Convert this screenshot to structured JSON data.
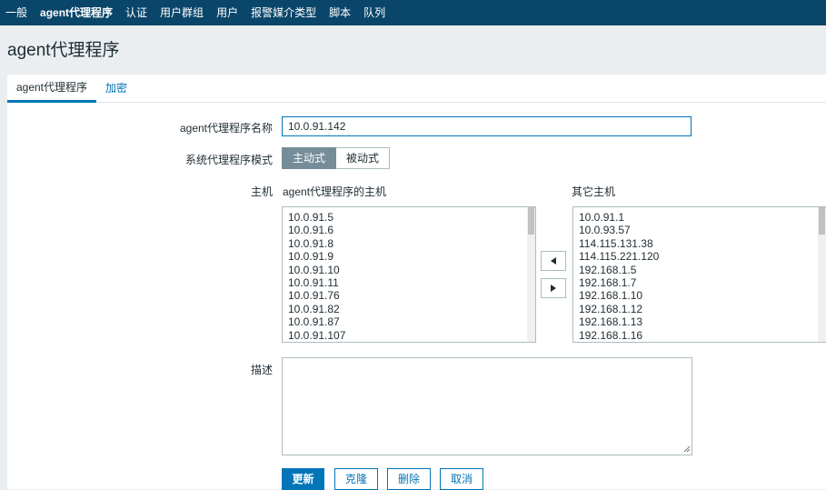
{
  "topnav": {
    "items": [
      {
        "label": "一般"
      },
      {
        "label": "agent代理程序"
      },
      {
        "label": "认证"
      },
      {
        "label": "用户群组"
      },
      {
        "label": "用户"
      },
      {
        "label": "报警媒介类型"
      },
      {
        "label": "脚本"
      },
      {
        "label": "队列"
      }
    ]
  },
  "page": {
    "title": "agent代理程序"
  },
  "tabs": {
    "active": "agent代理程序",
    "encryption": "加密"
  },
  "form": {
    "name_label": "agent代理程序名称",
    "name_value": "10.0.91.142",
    "mode_label": "系统代理程序模式",
    "mode_active": "主动式",
    "mode_passive": "被动式",
    "hosts_label": "主机",
    "proxy_hosts_header": "agent代理程序的主机",
    "other_hosts_header": "其它主机",
    "proxy_hosts": [
      "10.0.91.5",
      "10.0.91.6",
      "10.0.91.8",
      "10.0.91.9",
      "10.0.91.10",
      "10.0.91.11",
      "10.0.91.76",
      "10.0.91.82",
      "10.0.91.87",
      "10.0.91.107"
    ],
    "other_hosts": [
      "10.0.91.1",
      "10.0.93.57",
      "114.115.131.38",
      "114.115.221.120",
      "192.168.1.5",
      "192.168.1.7",
      "192.168.1.10",
      "192.168.1.12",
      "192.168.1.13",
      "192.168.1.16"
    ],
    "description_label": "描述",
    "description_value": ""
  },
  "buttons": {
    "update": "更新",
    "clone": "克隆",
    "delete": "删除",
    "cancel": "取消"
  },
  "colors": {
    "nav_bg": "#0a466a",
    "accent": "#0275b8",
    "selected_mode": "#768d99"
  }
}
